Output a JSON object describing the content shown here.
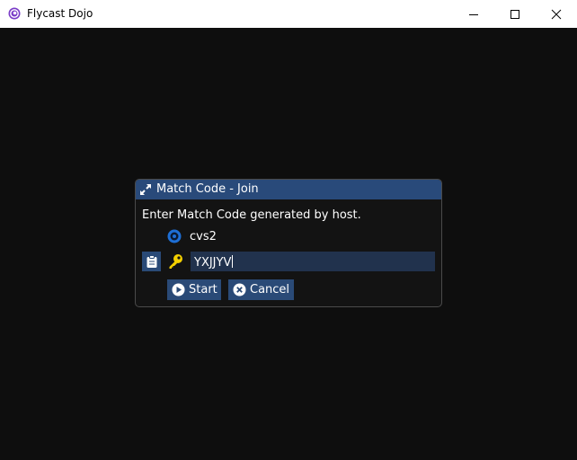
{
  "window": {
    "title": "Flycast Dojo"
  },
  "dialog": {
    "title": "Match Code - Join",
    "instruction": "Enter Match Code generated by host.",
    "game": "cvs2",
    "match_code": "YXJJYV",
    "start_label": "Start",
    "cancel_label": "Cancel"
  },
  "colors": {
    "header": "#294a7a",
    "button": "#2a4a77",
    "input": "#21324d",
    "game_icon": "#1e6fd6",
    "key_icon": "#f4d000",
    "background": "#0e0e0e"
  },
  "icons": {
    "app": "flycast-logo-icon",
    "collapse": "expand-arrows-icon",
    "game": "disc-icon",
    "paste": "clipboard-icon",
    "key": "key-icon",
    "start": "play-icon",
    "cancel": "close-circle-icon"
  }
}
